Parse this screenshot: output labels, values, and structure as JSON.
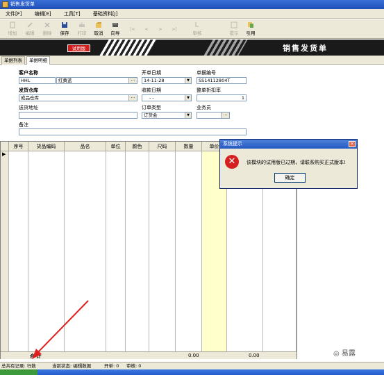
{
  "window": {
    "title": "销售发货单"
  },
  "menu": [
    "文件[F]",
    "编辑[E]",
    "工具[T]",
    "基础资料[J]"
  ],
  "toolbar": [
    {
      "label": "增加",
      "icon": "add-icon",
      "enabled": false
    },
    {
      "label": "编辑",
      "icon": "edit-icon",
      "enabled": false
    },
    {
      "label": "删除",
      "icon": "delete-icon",
      "enabled": false
    },
    {
      "label": "保存",
      "icon": "save-icon",
      "enabled": true
    },
    {
      "label": "打印",
      "icon": "print-icon",
      "enabled": false
    },
    {
      "label": "取消",
      "icon": "cancel-icon",
      "enabled": true
    },
    {
      "label": "向导",
      "icon": "wizard-icon",
      "enabled": true
    },
    {
      "label": "审核",
      "icon": "approve-icon",
      "enabled": false
    },
    {
      "label": "提示",
      "icon": "hint-icon",
      "enabled": false
    },
    {
      "label": "引用",
      "icon": "reference-icon",
      "enabled": true
    }
  ],
  "banner": {
    "trial_label": "试用版",
    "title": "销售发货单"
  },
  "tabs": [
    "单据列表",
    "单据明细"
  ],
  "form": {
    "customer_label": "客户名称",
    "customer_code": "HHL",
    "customer_name": "红黄蓝",
    "open_date_label": "开单日期",
    "open_date": "14-11-28",
    "doc_no_label": "单据编号",
    "doc_no": "SS14112804T",
    "warehouse_label": "发货仓库",
    "warehouse": "成品仓库",
    "collect_date_label": "收款日期",
    "collect_date": "- -",
    "discount_label": "整单折扣率",
    "discount": "1",
    "address_label": "送货地址",
    "address": "",
    "order_type_label": "订单类型",
    "order_type": "订货会",
    "staff_label": "业务员",
    "staff": "",
    "remark_label": "备注",
    "remark": ""
  },
  "grid": {
    "columns": [
      "序号",
      "货品编码",
      "品名",
      "单位",
      "颜色",
      "尺码",
      "数量",
      "单价"
    ],
    "total_label": "合    计",
    "total_amount_1": "0.00",
    "total_amount_2": "0.00"
  },
  "status": {
    "left": "总共有记录: 行数",
    "state": "当前状态: 编辑数据",
    "open": "开单: 0",
    "audit": "审核: 0"
  },
  "dialog": {
    "title": "系统提示",
    "message": "该模块的试用版已过期，请联系购买正式版本!",
    "ok_label": "确定"
  },
  "watermark": "易露"
}
